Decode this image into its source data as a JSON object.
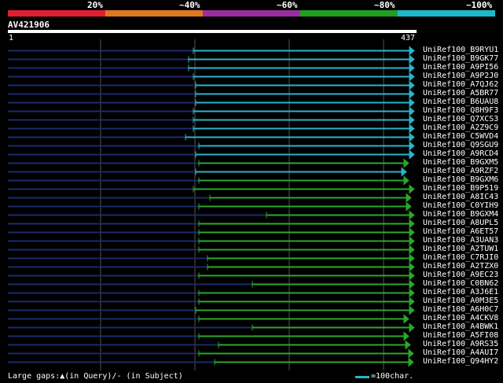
{
  "legend": {
    "segments": [
      {
        "label": "20%",
        "color": "#e02030"
      },
      {
        "label": "~40%",
        "color": "#e07820"
      },
      {
        "label": "~60%",
        "color": "#9a2ea0"
      },
      {
        "label": "~80%",
        "color": "#20a020"
      },
      {
        "label": "~100%",
        "color": "#20b8c8"
      }
    ]
  },
  "query": {
    "name": "AV421906",
    "start": "1",
    "end": "437"
  },
  "colors": {
    "cyan": "#2ab5c8",
    "green": "#2aa82a",
    "navy": "#1c2a6a",
    "grid": "#555555"
  },
  "hits": [
    {
      "name": "UniRef100_B9RYU1",
      "color": "cyan"
    },
    {
      "name": "UniRef100_B9GK77",
      "color": "cyan"
    },
    {
      "name": "UniRef100_A9PI56",
      "color": "cyan"
    },
    {
      "name": "UniRef100_A9P2J0",
      "color": "cyan"
    },
    {
      "name": "UniRef100_A7QJ62",
      "color": "cyan"
    },
    {
      "name": "UniRef100_A5BR77",
      "color": "cyan"
    },
    {
      "name": "UniRef100_B6UAU8",
      "color": "cyan"
    },
    {
      "name": "UniRef100_Q8H9F3",
      "color": "cyan"
    },
    {
      "name": "UniRef100_Q7XCS3",
      "color": "cyan"
    },
    {
      "name": "UniRef100_A2Z9C9",
      "color": "cyan"
    },
    {
      "name": "UniRef100_C5WVD4",
      "color": "cyan"
    },
    {
      "name": "UniRef100_Q9SGU9",
      "color": "cyan"
    },
    {
      "name": "UniRef100_A9RCD4",
      "color": "cyan"
    },
    {
      "name": "UniRef100_B9GXM5",
      "color": "green"
    },
    {
      "name": "UniRef100_A9RZF2",
      "color": "cyan"
    },
    {
      "name": "UniRef100_B9GXM6",
      "color": "green"
    },
    {
      "name": "UniRef100_B9P519",
      "color": "green"
    },
    {
      "name": "UniRef100_A8IC43",
      "color": "green"
    },
    {
      "name": "UniRef100_C0YIH9",
      "color": "green"
    },
    {
      "name": "UniRef100_B9GXM4",
      "color": "green"
    },
    {
      "name": "UniRef100_A8UPL5",
      "color": "green"
    },
    {
      "name": "UniRef100_A6ET57",
      "color": "green"
    },
    {
      "name": "UniRef100_A3UAN3",
      "color": "green"
    },
    {
      "name": "UniRef100_A2TUW1",
      "color": "green"
    },
    {
      "name": "UniRef100_C7RJI0",
      "color": "green"
    },
    {
      "name": "UniRef100_A2TZX0",
      "color": "green"
    },
    {
      "name": "UniRef100_A9EC23",
      "color": "green"
    },
    {
      "name": "UniRef100_C0BN62",
      "color": "green"
    },
    {
      "name": "UniRef100_A3J6E1",
      "color": "green"
    },
    {
      "name": "UniRef100_A0M3E5",
      "color": "green"
    },
    {
      "name": "UniRef100_A6H0C7",
      "color": "green"
    },
    {
      "name": "UniRef100_A4CKV8",
      "color": "green"
    },
    {
      "name": "UniRef100_A4BWK1",
      "color": "green"
    },
    {
      "name": "UniRef100_A5FI08",
      "color": "green"
    },
    {
      "name": "UniRef100_A9RS35",
      "color": "green"
    },
    {
      "name": "UniRef100_A4AUI7",
      "color": "green"
    },
    {
      "name": "UniRef100_Q94HY2",
      "color": "green"
    }
  ],
  "footer": {
    "gaps": "Large gaps:▲(in Query)/- (in Subject)",
    "scale": "=100char."
  }
}
